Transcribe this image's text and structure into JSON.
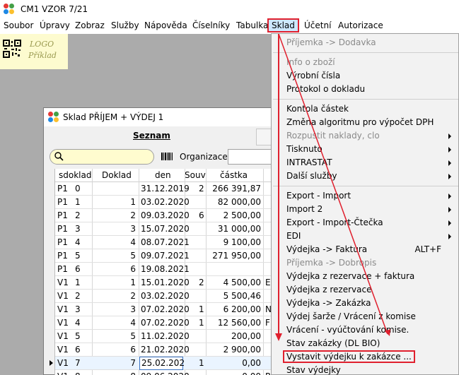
{
  "app": {
    "title": "CM1 VZOR 7/21"
  },
  "menubar": {
    "items": [
      "Soubor",
      "Úpravy",
      "Zobraz",
      "Služby",
      "Nápověda",
      "Číselníky",
      "Tabulka",
      "Sklad",
      "Účetní",
      "Autorizace"
    ],
    "active": "Sklad"
  },
  "logo": {
    "line1": "LOGO",
    "line2": "Příklad"
  },
  "window": {
    "title": "Sklad PŘÍJEM + VÝDEJ 1",
    "tab_label": "Seznam",
    "search_placeholder": "",
    "org_label": "Organizace"
  },
  "table": {
    "columns": [
      "sdoklad",
      "Doklad",
      "den",
      "Souv",
      "částka"
    ],
    "rows": [
      {
        "s": "P1",
        "sd": "0",
        "doklad": "",
        "den": "31.12.2019",
        "souv": "2",
        "castka": "266 391,87",
        "x": ""
      },
      {
        "s": "P1",
        "sd": "1",
        "doklad": "1",
        "den": "03.02.2020",
        "souv": "",
        "castka": "82 000,00",
        "x": ""
      },
      {
        "s": "P1",
        "sd": "2",
        "doklad": "2",
        "den": "09.03.2020",
        "souv": "6",
        "castka": "2 500,00",
        "x": ""
      },
      {
        "s": "P1",
        "sd": "3",
        "doklad": "3",
        "den": "15.07.2020",
        "souv": "",
        "castka": "31 000,00",
        "x": ""
      },
      {
        "s": "P1",
        "sd": "4",
        "doklad": "4",
        "den": "08.07.2021",
        "souv": "",
        "castka": "9 100,00",
        "x": ""
      },
      {
        "s": "P1",
        "sd": "5",
        "doklad": "5",
        "den": "09.07.2021",
        "souv": "",
        "castka": "271 950,00",
        "x": ""
      },
      {
        "s": "P1",
        "sd": "6",
        "doklad": "6",
        "den": "19.08.2021",
        "souv": "",
        "castka": "",
        "x": ""
      },
      {
        "s": "V1",
        "sd": "1",
        "doklad": "1",
        "den": "15.01.2020",
        "souv": "2",
        "castka": "4 500,00",
        "x": "E"
      },
      {
        "s": "V1",
        "sd": "2",
        "doklad": "2",
        "den": "03.02.2020",
        "souv": "",
        "castka": "5 500,46",
        "x": ""
      },
      {
        "s": "V1",
        "sd": "3",
        "doklad": "3",
        "den": "07.02.2020",
        "souv": "1",
        "castka": "6 200,00",
        "x": "N"
      },
      {
        "s": "V1",
        "sd": "4",
        "doklad": "4",
        "den": "07.02.2020",
        "souv": "1",
        "castka": "12 560,00",
        "x": "F"
      },
      {
        "s": "V1",
        "sd": "5",
        "doklad": "5",
        "den": "11.02.2020",
        "souv": "",
        "castka": "200,00",
        "x": ""
      },
      {
        "s": "V1",
        "sd": "6",
        "doklad": "6",
        "den": "21.02.2020",
        "souv": "",
        "castka": "2 900,00",
        "x": ""
      },
      {
        "s": "V1",
        "sd": "7",
        "doklad": "7",
        "den": "25.02.202",
        "souv": "1",
        "castka": "0,00",
        "x": ""
      },
      {
        "s": "V1",
        "sd": "8",
        "doklad": "8",
        "den": "09.06.2020",
        "souv": "",
        "castka": "0,00",
        "x": "R"
      }
    ],
    "selected_row": 13
  },
  "dropdown": {
    "items": [
      {
        "label": "Příjemka -> Dodavka",
        "disabled": true,
        "submenu": false,
        "shortcut": ""
      },
      {
        "sep": true
      },
      {
        "label": "Info o zboží",
        "disabled": true,
        "submenu": false,
        "shortcut": ""
      },
      {
        "label": "Výrobní čísla",
        "disabled": false,
        "submenu": false,
        "shortcut": ""
      },
      {
        "label": "Protokol o dokladu",
        "disabled": false,
        "submenu": false,
        "shortcut": ""
      },
      {
        "sep": true
      },
      {
        "label": "Kontola částek",
        "disabled": false,
        "submenu": false,
        "shortcut": ""
      },
      {
        "label": "Změna algoritmu pro výpočet DPH",
        "disabled": false,
        "submenu": false,
        "shortcut": ""
      },
      {
        "label": "Rozpustit naklady, clo",
        "disabled": true,
        "submenu": true,
        "shortcut": ""
      },
      {
        "label": "Tisknuto",
        "disabled": false,
        "submenu": true,
        "shortcut": ""
      },
      {
        "label": "INTRASTAT",
        "disabled": false,
        "submenu": true,
        "shortcut": ""
      },
      {
        "label": "Další služby",
        "disabled": false,
        "submenu": true,
        "shortcut": ""
      },
      {
        "sep": true
      },
      {
        "label": "Export - Import",
        "disabled": false,
        "submenu": true,
        "shortcut": ""
      },
      {
        "label": "Import 2",
        "disabled": false,
        "submenu": true,
        "shortcut": ""
      },
      {
        "label": "Export - Import-Čtečka",
        "disabled": false,
        "submenu": true,
        "shortcut": ""
      },
      {
        "label": "EDI",
        "disabled": false,
        "submenu": true,
        "shortcut": ""
      },
      {
        "label": "Výdejka -> Faktura",
        "disabled": false,
        "submenu": false,
        "shortcut": "ALT+F"
      },
      {
        "label": "Příjemka -> Dobropis",
        "disabled": true,
        "submenu": false,
        "shortcut": ""
      },
      {
        "label": "Výdejka z rezervace + faktura",
        "disabled": false,
        "submenu": false,
        "shortcut": ""
      },
      {
        "label": "Výdejka z rezervace",
        "disabled": false,
        "submenu": false,
        "shortcut": ""
      },
      {
        "label": "Výdejka -> Zakázka",
        "disabled": false,
        "submenu": false,
        "shortcut": ""
      },
      {
        "label": "Výdej šarže / Vrácení z komise",
        "disabled": false,
        "submenu": false,
        "shortcut": ""
      },
      {
        "label": "Vrácení - vyúčtování komise.",
        "disabled": false,
        "submenu": false,
        "shortcut": ""
      },
      {
        "label": "Stav zakázky (DL BIO)",
        "disabled": false,
        "submenu": false,
        "shortcut": ""
      },
      {
        "label": "Vystavit výdejku k zakázce ...",
        "disabled": false,
        "submenu": false,
        "shortcut": "",
        "highlighted": true
      },
      {
        "label": "Stav výdejky",
        "disabled": false,
        "submenu": false,
        "shortcut": ""
      }
    ]
  },
  "colors": {
    "annotation_red": "#e0202e",
    "menu_highlight": "#cde8ff",
    "logo_bg": "#fdfbcf",
    "search_bg": "#fffccf"
  }
}
